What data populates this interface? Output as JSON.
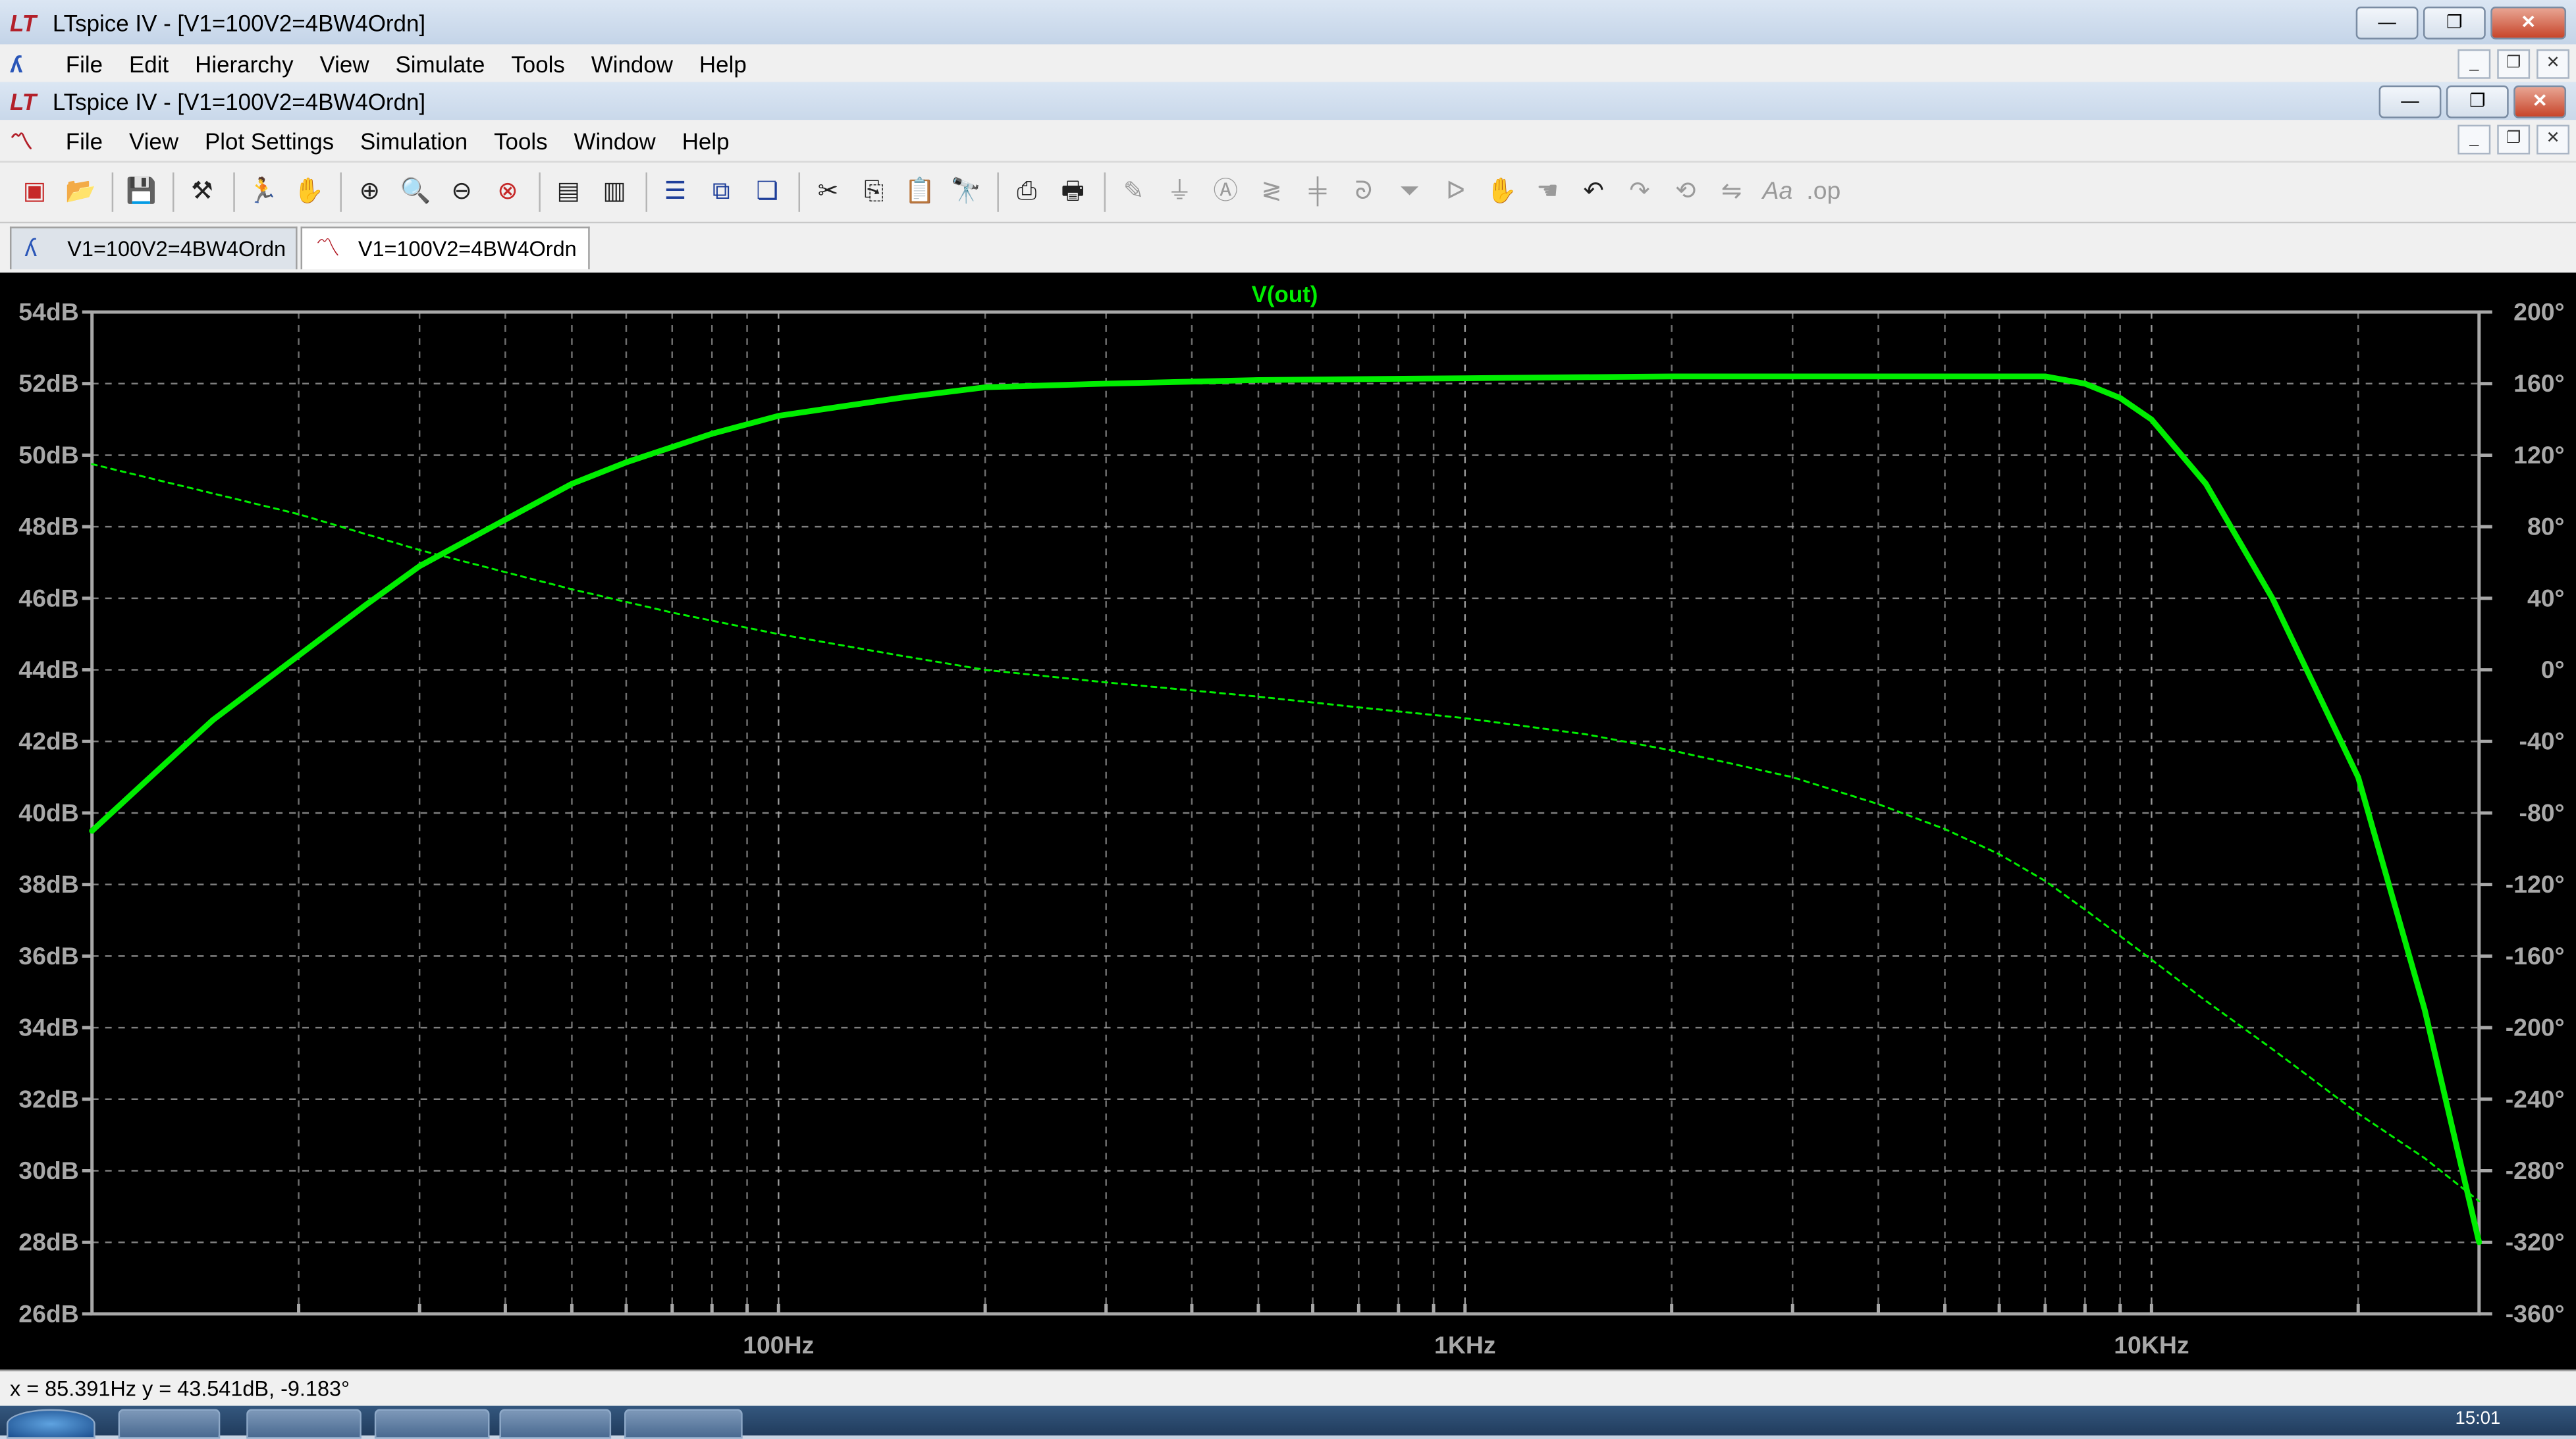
{
  "main_window": {
    "title": "LTspice IV - [V1=100V2=4BW4Ordn]",
    "menu": [
      "File",
      "Edit",
      "Hierarchy",
      "View",
      "Simulate",
      "Tools",
      "Window",
      "Help"
    ]
  },
  "child_window": {
    "title": "LTspice IV - [V1=100V2=4BW4Ordn]",
    "menu": [
      "File",
      "View",
      "Plot Settings",
      "Simulation",
      "Tools",
      "Window",
      "Help"
    ]
  },
  "tabs": [
    {
      "label": "V1=100V2=4BW4Ordn",
      "kind": "schematic"
    },
    {
      "label": "V1=100V2=4BW4Ordn",
      "kind": "waveform",
      "active": true
    }
  ],
  "toolbar_icons": [
    "new-schematic-icon",
    "open-icon",
    "save-icon",
    "control-panel-icon",
    "run-icon",
    "halt-icon",
    "zoom-in-icon",
    "zoom-fit-icon",
    "zoom-out-icon",
    "zoom-cancel-icon",
    "autorange-icon",
    "plot-pane-icon",
    "tile-horizontal-icon",
    "tile-vertical-icon",
    "cascade-icon",
    "cut-icon",
    "copy-icon",
    "paste-icon",
    "find-icon",
    "print-preview-icon",
    "print-icon",
    "wire-icon",
    "ground-icon",
    "label-icon",
    "resistor-icon",
    "capacitor-icon",
    "inductor-icon",
    "diode-icon",
    "component-icon",
    "move-icon",
    "drag-icon",
    "undo-icon",
    "redo-icon",
    "rotate-icon",
    "mirror-icon",
    "text-icon",
    "spice-directive-icon"
  ],
  "status": {
    "text": "x = 85.391Hz    y = 43.541dB, -9.183°"
  },
  "taskbar": {
    "clock": "15:01"
  },
  "colors": {
    "trace": "#00ee00",
    "grid": "#a8a8a8",
    "background": "#000000"
  },
  "chart_data": {
    "type": "line",
    "title": "V(out)",
    "x_scale": "log",
    "xlim": [
      10,
      30000
    ],
    "x_tick_labels": [
      {
        "x": 100,
        "label": "100Hz"
      },
      {
        "x": 1000,
        "label": "1KHz"
      },
      {
        "x": 10000,
        "label": "10KHz"
      }
    ],
    "ylim_left": [
      26,
      54
    ],
    "y_left_ticks": [
      54,
      52,
      50,
      48,
      46,
      44,
      42,
      40,
      38,
      36,
      34,
      32,
      30,
      28,
      26
    ],
    "y_left_labels": [
      "54dB",
      "52dB",
      "50dB",
      "48dB",
      "46dB",
      "44dB",
      "42dB",
      "40dB",
      "38dB",
      "36dB",
      "34dB",
      "32dB",
      "30dB",
      "28dB",
      "26dB"
    ],
    "ylim_right": [
      -360,
      200
    ],
    "y_right_ticks": [
      200,
      160,
      120,
      80,
      40,
      0,
      -40,
      -80,
      -120,
      -160,
      -200,
      -240,
      -280,
      -320,
      -360
    ],
    "y_right_labels": [
      "200°",
      "160°",
      "120°",
      "80°",
      "40°",
      "0°",
      "-40°",
      "-80°",
      "-120°",
      "-160°",
      "-200°",
      "-240°",
      "-280°",
      "-320°",
      "-360°"
    ],
    "grid": true,
    "series": [
      {
        "name": "V(out)",
        "kind": "magnitude",
        "axis": "left",
        "style": "solid",
        "x": [
          10,
          12,
          15,
          20,
          25,
          30,
          40,
          50,
          60,
          80,
          100,
          150,
          200,
          300,
          500,
          1000,
          2000,
          4000,
          6000,
          7000,
          8000,
          9000,
          10000,
          12000,
          15000,
          20000,
          25000,
          30000
        ],
        "y": [
          39.5,
          40.9,
          42.6,
          44.4,
          45.8,
          46.9,
          48.2,
          49.2,
          49.8,
          50.6,
          51.1,
          51.6,
          51.9,
          52.0,
          52.1,
          52.15,
          52.2,
          52.2,
          52.2,
          52.2,
          52.0,
          51.6,
          51.0,
          49.2,
          46.0,
          41.0,
          34.5,
          28.0
        ]
      },
      {
        "name": "V(out)",
        "kind": "phase",
        "axis": "right",
        "style": "dashed",
        "x": [
          10,
          20,
          30,
          50,
          70,
          100,
          150,
          200,
          300,
          500,
          700,
          1000,
          1500,
          2000,
          3000,
          4000,
          5000,
          6000,
          7000,
          8000,
          10000,
          12000,
          15000,
          20000,
          25000,
          30000
        ],
        "y": [
          115,
          87,
          67,
          45,
          32,
          20,
          8,
          0,
          -7,
          -15,
          -21,
          -27,
          -36,
          -45,
          -60,
          -75,
          -89,
          -103,
          -118,
          -134,
          -162,
          -185,
          -212,
          -248,
          -273,
          -297
        ]
      }
    ]
  }
}
